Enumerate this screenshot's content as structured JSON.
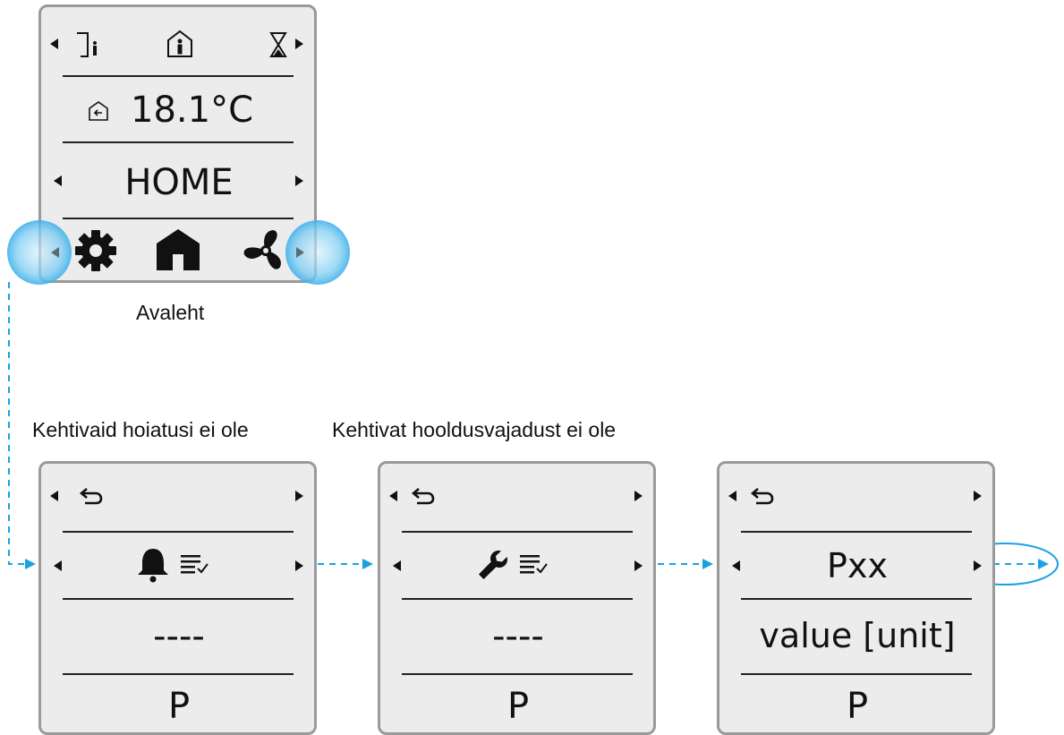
{
  "home": {
    "temperature": "18.1°C",
    "mode": "HOME",
    "caption": "Avaleht",
    "top_icons": [
      "away-icon",
      "home-person-icon",
      "hourglass-icon"
    ],
    "bottom_icons": [
      "gear-icon",
      "house-icon",
      "fan-icon"
    ],
    "temp_icon": "home-return-icon"
  },
  "captions": {
    "alarms": "Kehtivaid hoiatusi ei ole",
    "service": "Kehtivat hooldusvajadust ei ole"
  },
  "screens": [
    {
      "icons": [
        "back-icon",
        "bell-icon",
        "checklist-icon"
      ],
      "value": "----",
      "footer": "P"
    },
    {
      "icons": [
        "back-icon",
        "wrench-icon",
        "checklist-icon"
      ],
      "value": "----",
      "footer": "P"
    },
    {
      "icons": [
        "back-icon"
      ],
      "title": "Pxx",
      "value": "value [unit]",
      "footer": "P"
    }
  ],
  "colors": {
    "accent": "#1aa1e3",
    "panel": "#ececec",
    "border": "#9a9a9a"
  }
}
